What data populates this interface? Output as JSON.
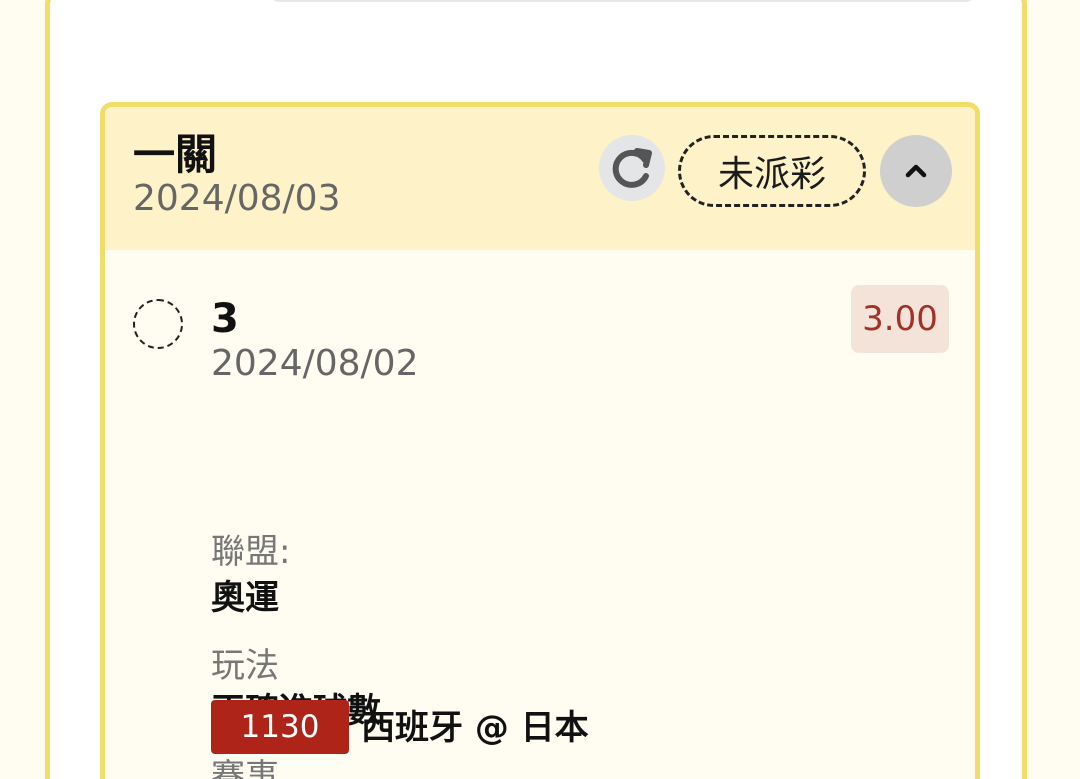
{
  "bet": {
    "type": "一關",
    "date": "2024/08/03",
    "status": "未派彩",
    "selection": {
      "value": "3",
      "date": "2024/08/02",
      "odds": "3.00"
    },
    "details": {
      "league_label": "聯盟:",
      "league_value": "奧運",
      "play_label": "玩法",
      "play_value": "正確進球數",
      "event_label": "賽事",
      "match_code": "1130",
      "match_name": "西班牙 @ 日本"
    }
  },
  "icons": {
    "refresh": "refresh-icon",
    "collapse": "chevron-up-icon",
    "selection": "dashed-radio-icon"
  },
  "colors": {
    "accent_yellow": "#f2dc6a",
    "header_background": "#fdf2c8",
    "body_background": "#fffdf2",
    "odds_text": "#a23229",
    "match_code_background": "#ae2419"
  }
}
